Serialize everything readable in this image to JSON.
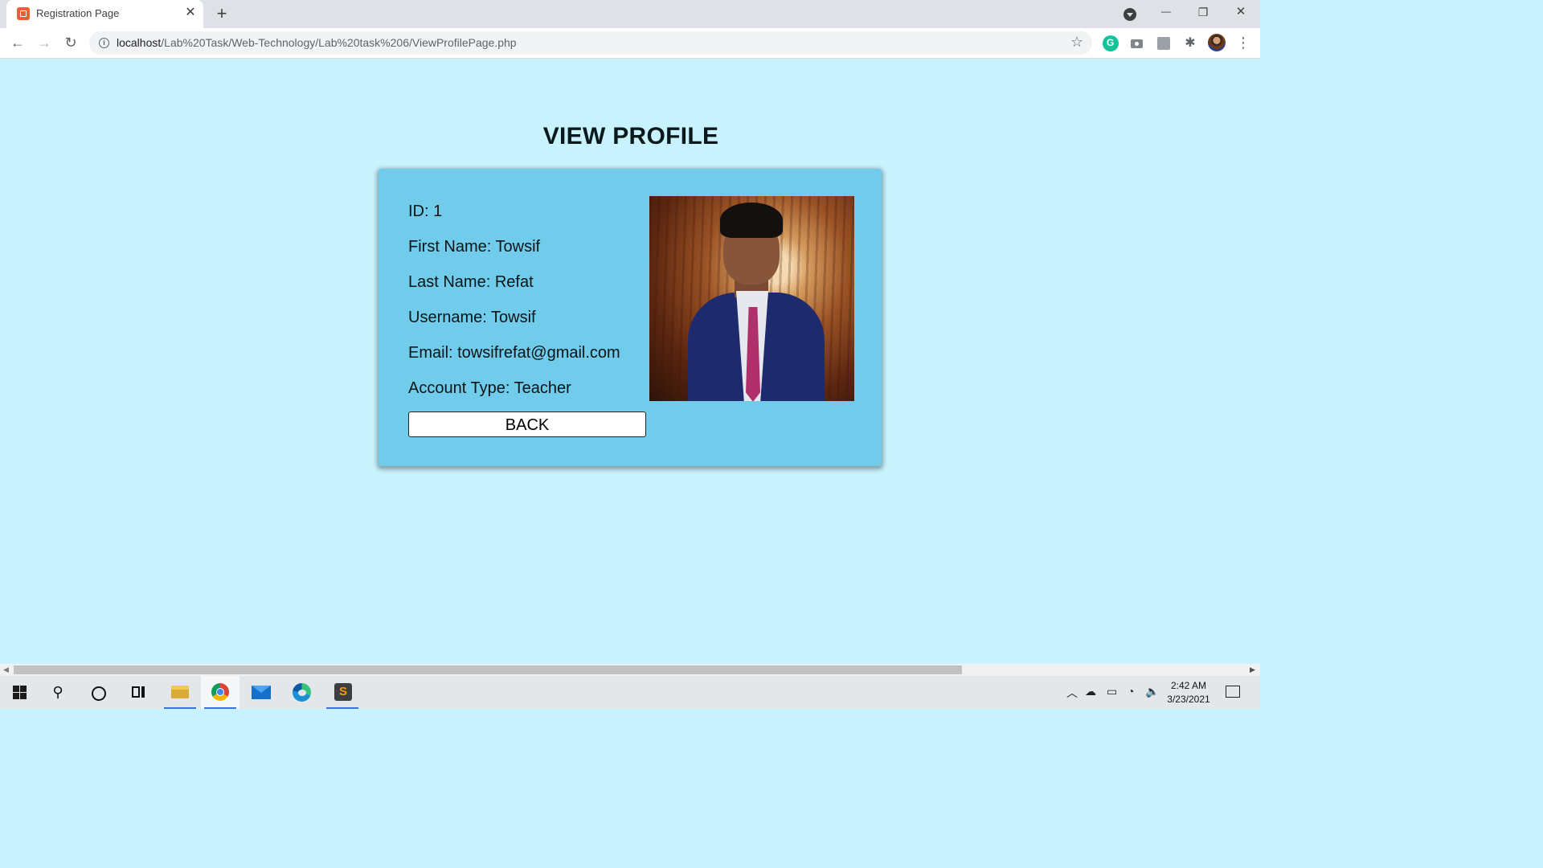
{
  "browser": {
    "tab_title": "Registration Page",
    "tab_close": "✕",
    "new_tab": "+",
    "url_host": "localhost",
    "url_path": "/Lab%20Task/Web-Technology/Lab%20task%206/ViewProfilePage.php",
    "window_minimize": "—",
    "window_restore": "❐",
    "window_close": "✕",
    "back": "←",
    "forward": "→",
    "reload": "↻",
    "star": "☆",
    "menu": "⋮",
    "extensions": [
      "grammarly-icon",
      "camera-icon",
      "extension-icon",
      "puzzle-icon"
    ]
  },
  "page": {
    "title": "VIEW PROFILE",
    "fields": [
      {
        "label": "ID: 1"
      },
      {
        "label": "First Name: Towsif"
      },
      {
        "label": "Last Name: Refat"
      },
      {
        "label": "Username: Towsif"
      },
      {
        "label": "Email: towsifrefat@gmail.com"
      },
      {
        "label": "Account Type: Teacher"
      }
    ],
    "back_button": "BACK",
    "photo_alt": "profile-photo"
  },
  "taskbar": {
    "time": "2:42 AM",
    "date": "3/23/2021",
    "apps": [
      "start",
      "search",
      "cortana",
      "task-view",
      "file-explorer",
      "chrome",
      "mail",
      "edge",
      "sublime-text"
    ]
  },
  "colors": {
    "page_background": "#c8f2fd",
    "card_background": "#71cbea",
    "title_color": "#0a1a1c"
  }
}
